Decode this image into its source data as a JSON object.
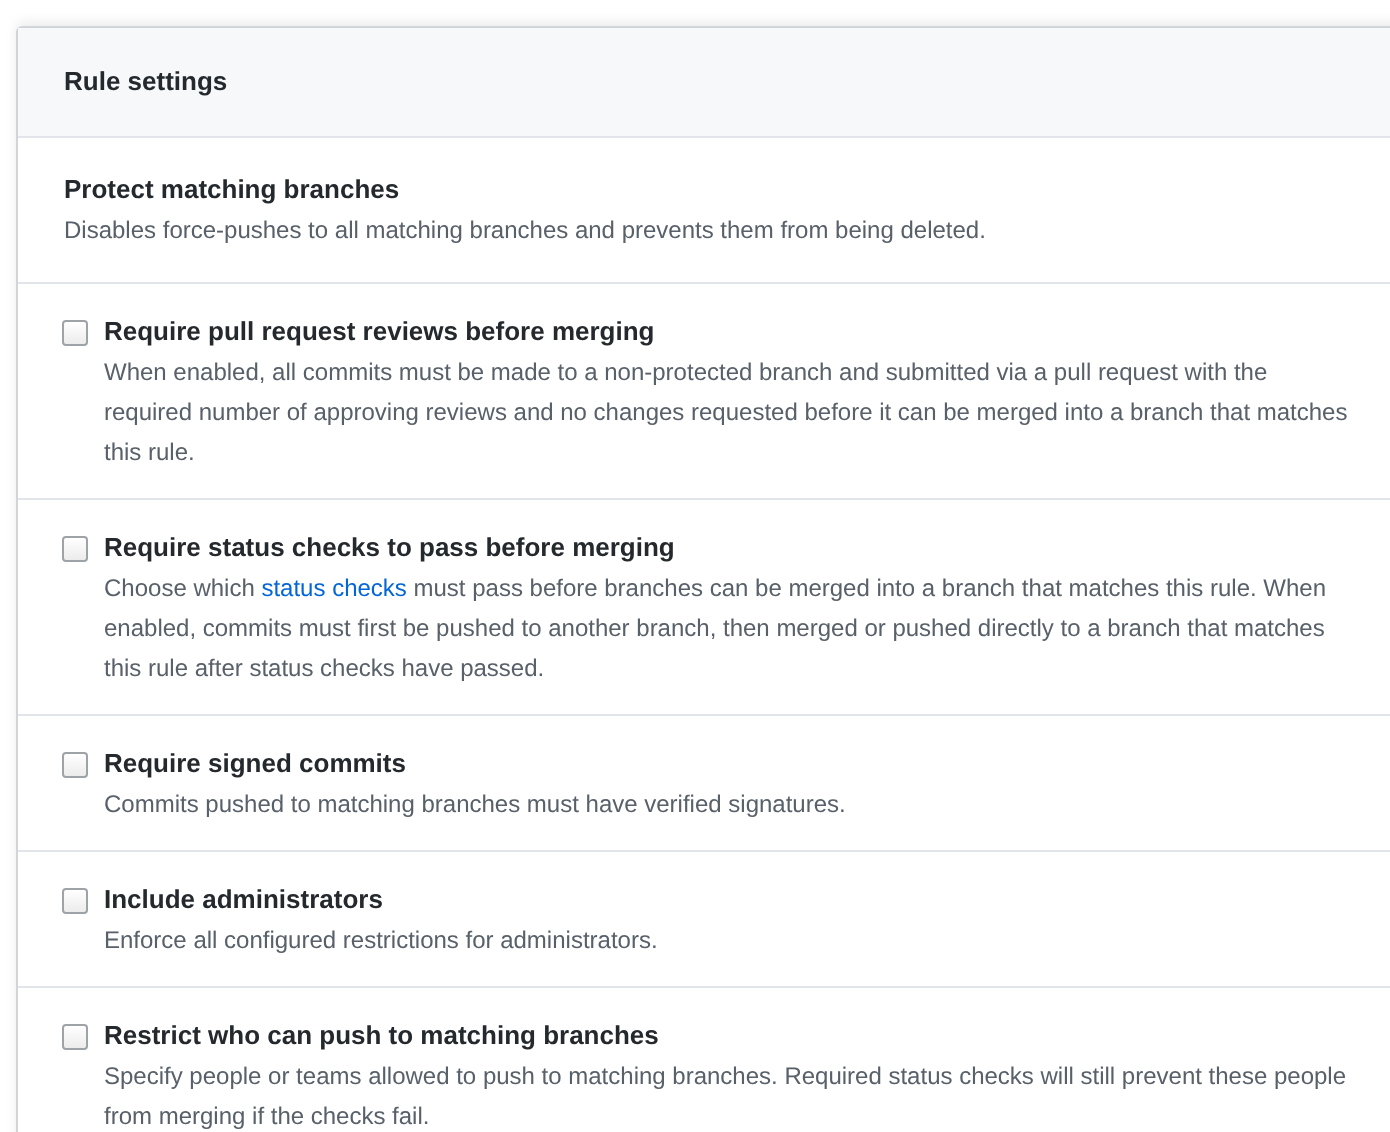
{
  "card": {
    "title": "Rule settings"
  },
  "protect": {
    "title": "Protect matching branches",
    "description": "Disables force-pushes to all matching branches and prevents them from being deleted."
  },
  "options": [
    {
      "title": "Require pull request reviews before merging",
      "checked": false,
      "description": [
        {
          "kind": "text",
          "text": "When enabled, all commits must be made to a non-protected branch and submitted via a pull request with the required number of approving reviews and no changes requested before it can be merged into a branch that matches this rule."
        }
      ]
    },
    {
      "title": "Require status checks to pass before merging",
      "checked": false,
      "description": [
        {
          "kind": "text",
          "text": "Choose which "
        },
        {
          "kind": "link",
          "text": "status checks"
        },
        {
          "kind": "text",
          "text": " must pass before branches can be merged into a branch that matches this rule. When enabled, commits must first be pushed to another branch, then merged or pushed directly to a branch that matches this rule after status checks have passed."
        }
      ]
    },
    {
      "title": "Require signed commits",
      "checked": false,
      "description": [
        {
          "kind": "text",
          "text": "Commits pushed to matching branches must have verified signatures."
        }
      ]
    },
    {
      "title": "Include administrators",
      "checked": false,
      "description": [
        {
          "kind": "text",
          "text": "Enforce all configured restrictions for administrators."
        }
      ]
    },
    {
      "title": "Restrict who can push to matching branches",
      "checked": false,
      "description": [
        {
          "kind": "text",
          "text": "Specify people or teams allowed to push to matching branches. Required status checks will still prevent these people from merging if the checks fail."
        }
      ]
    }
  ]
}
